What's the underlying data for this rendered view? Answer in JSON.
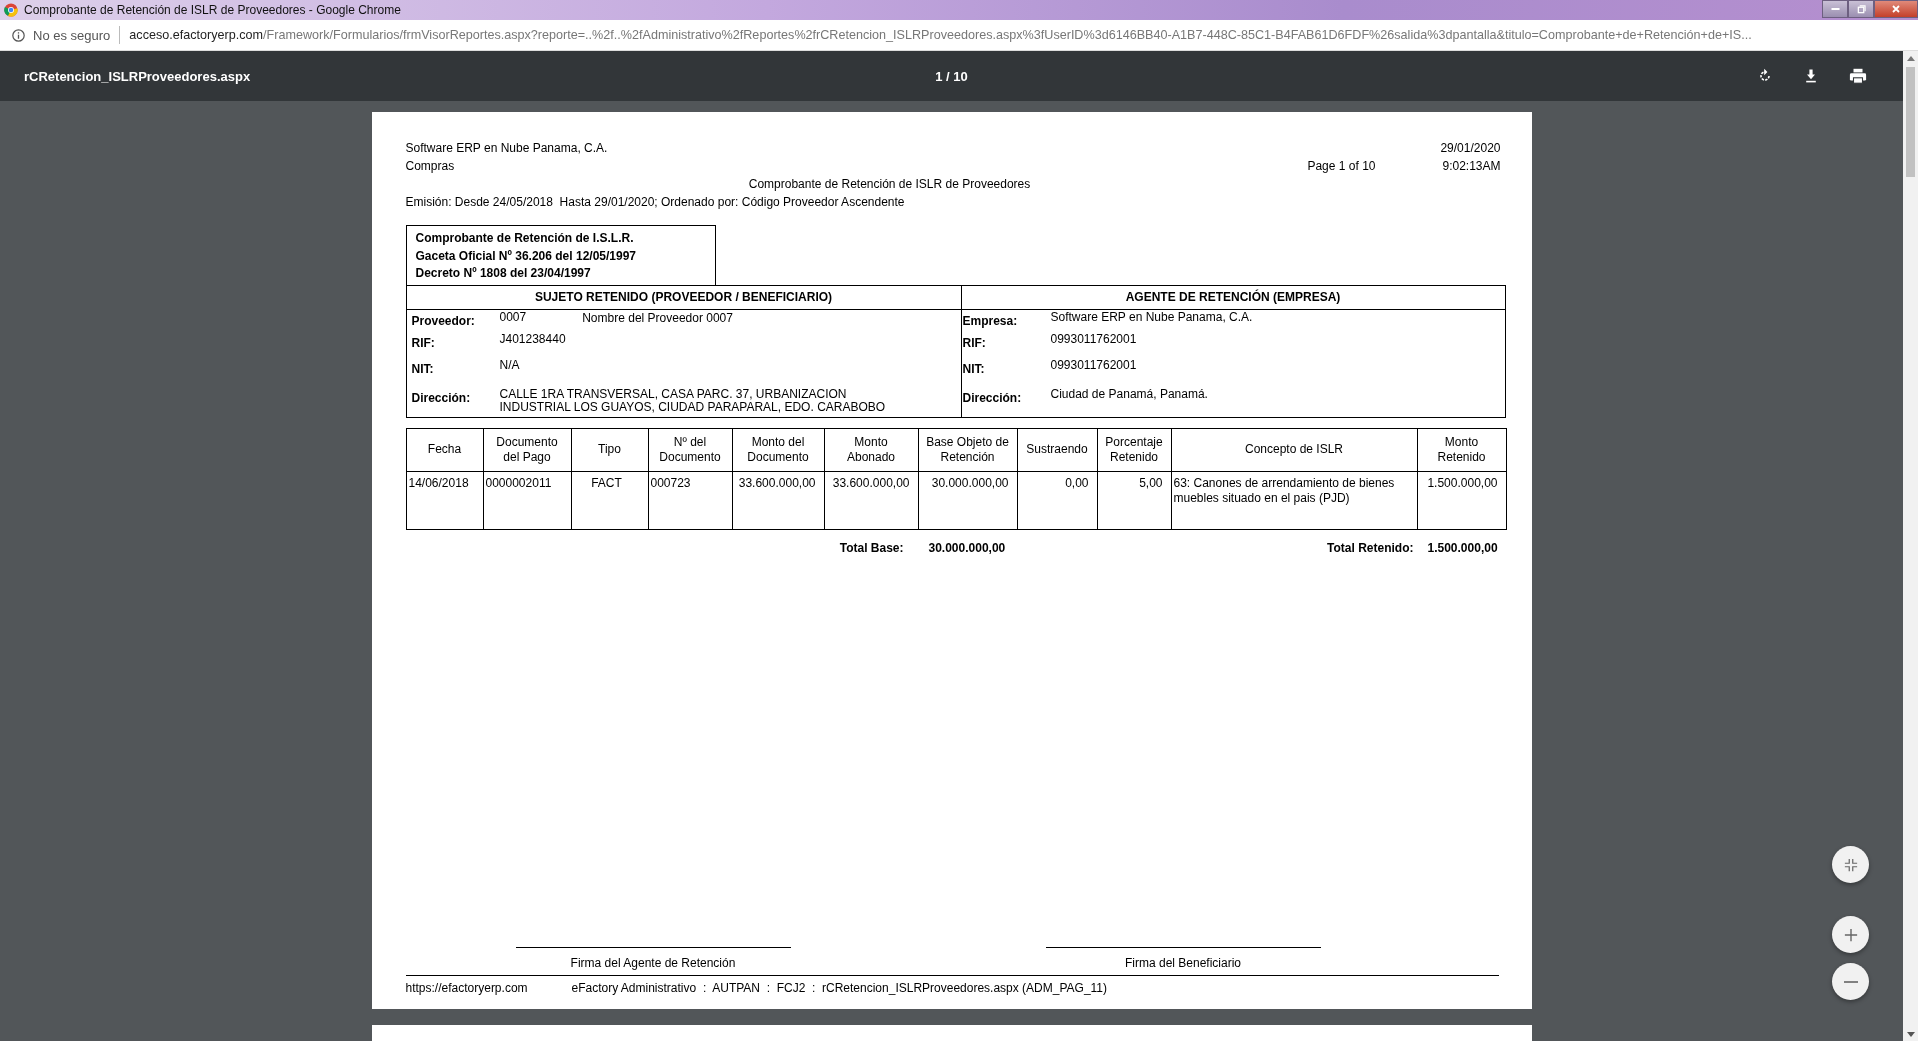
{
  "window": {
    "title": "Comprobante de Retención de ISLR de Proveedores - Google Chrome"
  },
  "address_bar": {
    "security": "No es seguro",
    "url_domain": "acceso.efactoryerp.com",
    "url_path": "/Framework/Formularios/frmVisorReportes.aspx?reporte=..%2f..%2fAdministrativo%2fReportes%2frCRetencion_ISLRProveedores.aspx%3fUserID%3d6146BB40-A1B7-448C-85C1-B4FAB61D6FDF%26salida%3dpantalla&titulo=Comprobante+de+Retención+de+IS..."
  },
  "viewer": {
    "file_name": "rCRetencion_ISLRProveedores.aspx",
    "page_counter": "1 / 10"
  },
  "report": {
    "header": {
      "company": "Software ERP en Nube Panama, C.A.",
      "department": "Compras",
      "date": "29/01/2020",
      "page": "Page 1 of 10",
      "time": "9:02:13AM",
      "title": "Comprobante de Retención de ISLR de Proveedores",
      "emission": "Emisión: Desde 24/05/2018  Hasta 29/01/2020; Ordenado por: Código Proveedor Ascendente"
    },
    "legal_box": [
      "Comprobante de Retención de I.S.L.R.",
      "Gaceta Oficial Nº 36.206 del 12/05/1997",
      "Decreto Nº 1808 del 23/04/1997"
    ],
    "parties": [
      {
        "heading": "SUJETO RETENIDO (PROVEEDOR / BENEFICIARIO)",
        "fields": [
          {
            "label": "Proveedor:",
            "value": "0007",
            "extra": "Nombre del Proveedor 0007"
          },
          {
            "label": "RIF:",
            "value": "J401238440"
          },
          {
            "label": "NIT:",
            "value": "N/A"
          },
          {
            "label": "Dirección:",
            "value": "CALLE 1RA TRANSVERSAL, CASA PARC. 37, URBANIZACION INDUSTRIAL LOS GUAYOS, CIUDAD PARAPARAL, EDO. CARABOBO"
          }
        ]
      },
      {
        "heading": "AGENTE DE RETENCIÓN (EMPRESA)",
        "fields": [
          {
            "label": "Empresa:",
            "value": "Software ERP en Nube Panama, C.A."
          },
          {
            "label": "RIF:",
            "value": "0993011762001"
          },
          {
            "label": "NIT:",
            "value": "0993011762001"
          },
          {
            "label": "Dirección:",
            "value": "Ciudad de Panamá, Panamá."
          }
        ]
      }
    ],
    "table": {
      "columns": [
        "Fecha",
        "Documento del Pago",
        "Tipo",
        "Nº del Documento",
        "Monto del Documento",
        "Monto Abonado",
        "Base Objeto de Retención",
        "Sustraendo",
        "Porcentaje Retenido",
        "Concepto de ISLR",
        "Monto Retenido"
      ],
      "rows": [
        [
          "14/06/2018",
          "0000002011",
          "FACT",
          "000723",
          "33.600.000,00",
          "33.600.000,00",
          "30.000.000,00",
          "0,00",
          "5,00",
          "63: Canones de arrendamiento de bienes muebles situado en el pais (PJD)",
          "1.500.000,00"
        ]
      ]
    },
    "totals": [
      {
        "label": "Total Base:",
        "value": "30.000.000,00"
      },
      {
        "label": "Total Retenido:",
        "value": "1.500.000,00"
      }
    ],
    "signatures": [
      "Firma del Agente de Retención",
      "Firma del Beneficiario"
    ],
    "footer": {
      "url": "https://efactoryerp.com",
      "info": "eFactory Administrativo  :  AUTPAN  :  FCJ2  :  rCRetencion_ISLRProveedores.aspx (ADM_PAG_11)"
    }
  }
}
